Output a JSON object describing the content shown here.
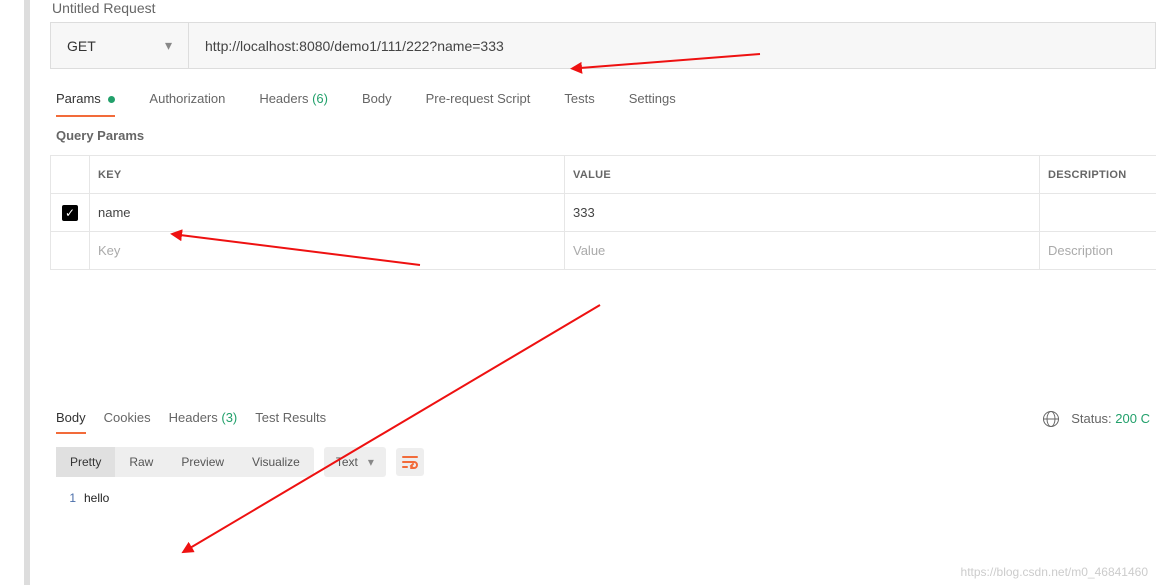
{
  "header": {
    "title": "Untitled Request"
  },
  "request": {
    "method": "GET",
    "url": "http://localhost:8080/demo1/111/222?name=333"
  },
  "reqTabs": {
    "params": "Params",
    "authorization": "Authorization",
    "headers": "Headers",
    "headers_count": "(6)",
    "body": "Body",
    "prerequest": "Pre-request Script",
    "tests": "Tests",
    "settings": "Settings"
  },
  "queryParams": {
    "label": "Query Params",
    "columns": {
      "key": "KEY",
      "value": "VALUE",
      "description": "DESCRIPTION"
    },
    "rows": [
      {
        "checked": true,
        "key": "name",
        "value": "333",
        "description": ""
      }
    ],
    "placeholders": {
      "key": "Key",
      "value": "Value",
      "description": "Description"
    }
  },
  "respTabs": {
    "body": "Body",
    "cookies": "Cookies",
    "headers": "Headers",
    "headers_count": "(3)",
    "testresults": "Test Results"
  },
  "status": {
    "label": "Status:",
    "code": "200 C"
  },
  "viewModes": {
    "pretty": "Pretty",
    "raw": "Raw",
    "preview": "Preview",
    "visualize": "Visualize"
  },
  "format": {
    "text": "Text"
  },
  "response": {
    "lines": [
      {
        "num": "1",
        "text": "hello"
      }
    ]
  },
  "watermark": "https://blog.csdn.net/m0_46841460"
}
